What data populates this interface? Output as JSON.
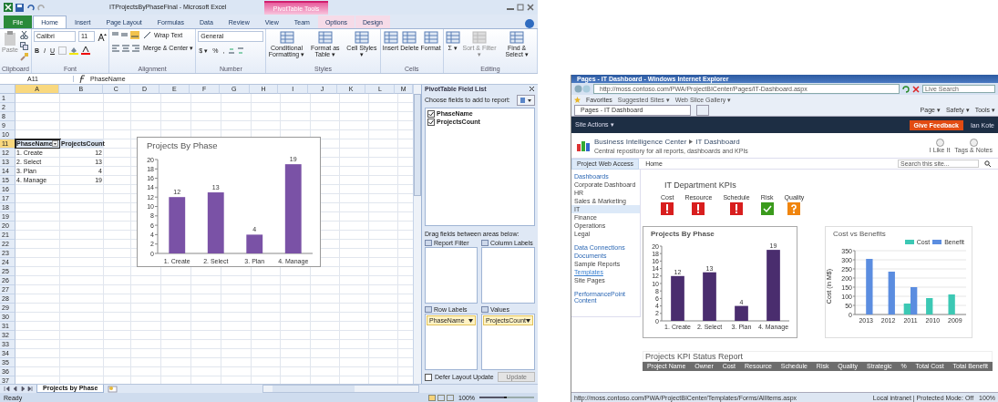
{
  "excel": {
    "title": "ITProjectsByPhaseFinal - Microsoft Excel",
    "context_label": "PivotTable Tools",
    "tabs": [
      {
        "label": "File",
        "kind": "file",
        "selected": false
      },
      {
        "label": "Home",
        "kind": "tab",
        "selected": true
      },
      {
        "label": "Insert",
        "kind": "tab",
        "selected": false
      },
      {
        "label": "Page Layout",
        "kind": "tab",
        "selected": false
      },
      {
        "label": "Formulas",
        "kind": "tab",
        "selected": false
      },
      {
        "label": "Data",
        "kind": "tab",
        "selected": false
      },
      {
        "label": "Review",
        "kind": "tab",
        "selected": false
      },
      {
        "label": "View",
        "kind": "tab",
        "selected": false
      },
      {
        "label": "Team",
        "kind": "tab",
        "selected": false
      },
      {
        "label": "Options",
        "kind": "context",
        "selected": false
      },
      {
        "label": "Design",
        "kind": "context",
        "selected": false
      }
    ],
    "groups": [
      {
        "kind": "clipboard",
        "label": "Clipboard",
        "buttons": [
          {
            "label": "Paste",
            "disabled": true
          }
        ]
      },
      {
        "kind": "font",
        "label": "Font",
        "font": "Calibri",
        "size": "11",
        "styles": [
          "B",
          "I",
          "U"
        ]
      },
      {
        "kind": "alignment",
        "label": "Alignment",
        "wrap": "Wrap Text",
        "merge": "Merge & Center ▾"
      },
      {
        "kind": "number",
        "label": "Number",
        "format": "General",
        "symbols": [
          "$ ▾",
          "%",
          ","
        ]
      },
      {
        "kind": "buttons",
        "label": "Styles",
        "buttons": [
          {
            "label": "Conditional Formatting ▾",
            "disabled": false
          },
          {
            "label": "Format as Table ▾",
            "disabled": false
          },
          {
            "label": "Cell Styles ▾",
            "disabled": false
          }
        ]
      },
      {
        "kind": "buttons",
        "label": "Cells",
        "buttons": [
          {
            "label": "Insert",
            "disabled": false
          },
          {
            "label": "Delete",
            "disabled": false
          },
          {
            "label": "Format",
            "disabled": false
          }
        ]
      },
      {
        "kind": "buttons",
        "label": "Editing",
        "buttons": [
          {
            "label": "Σ ▾",
            "disabled": false
          },
          {
            "label": "Sort & Filter ▾",
            "disabled": true
          },
          {
            "label": "Find & Select ▾",
            "disabled": false
          }
        ]
      }
    ],
    "name_box": "A11",
    "formula": "PhaseName",
    "columns": [
      {
        "label": "A",
        "selected": true
      },
      {
        "label": "B",
        "selected": false
      },
      {
        "label": "C",
        "selected": false
      },
      {
        "label": "D",
        "selected": false
      },
      {
        "label": "E",
        "selected": false
      },
      {
        "label": "F",
        "selected": false
      },
      {
        "label": "G",
        "selected": false
      },
      {
        "label": "H",
        "selected": false
      },
      {
        "label": "I",
        "selected": false
      },
      {
        "label": "J",
        "selected": false
      },
      {
        "label": "K",
        "selected": false
      },
      {
        "label": "L",
        "selected": false
      },
      {
        "label": "M",
        "selected": false
      }
    ],
    "rows": [
      {
        "label": "1",
        "selected": false,
        "cells": []
      },
      {
        "label": "2",
        "selected": false,
        "cells": []
      },
      {
        "label": "8",
        "selected": false,
        "cells": []
      },
      {
        "label": "9",
        "selected": false,
        "cells": []
      },
      {
        "label": "10",
        "selected": false,
        "cells": []
      },
      {
        "label": "11",
        "selected": true,
        "cells": [
          {
            "text": "PhaseName",
            "kind": "header",
            "selected": true
          },
          {
            "text": "ProjectsCount",
            "kind": "header",
            "selected": false
          }
        ]
      },
      {
        "label": "12",
        "selected": false,
        "cells": [
          {
            "text": "1. Create",
            "kind": "text",
            "selected": false
          },
          {
            "text": "12",
            "kind": "number",
            "selected": false
          }
        ]
      },
      {
        "label": "13",
        "selected": false,
        "cells": [
          {
            "text": "2. Select",
            "kind": "text",
            "selected": false
          },
          {
            "text": "13",
            "kind": "number",
            "selected": false
          }
        ]
      },
      {
        "label": "14",
        "selected": false,
        "cells": [
          {
            "text": "3. Plan",
            "kind": "text",
            "selected": false
          },
          {
            "text": "4",
            "kind": "number",
            "selected": false
          }
        ]
      },
      {
        "label": "15",
        "selected": false,
        "cells": [
          {
            "text": "4. Manage",
            "kind": "text",
            "selected": false
          },
          {
            "text": "19",
            "kind": "number",
            "selected": false
          }
        ]
      },
      {
        "label": "16",
        "selected": false,
        "cells": []
      },
      {
        "label": "17",
        "selected": false,
        "cells": []
      },
      {
        "label": "18",
        "selected": false,
        "cells": []
      },
      {
        "label": "19",
        "selected": false,
        "cells": []
      },
      {
        "label": "20",
        "selected": false,
        "cells": []
      },
      {
        "label": "21",
        "selected": false,
        "cells": []
      },
      {
        "label": "22",
        "selected": false,
        "cells": []
      },
      {
        "label": "23",
        "selected": false,
        "cells": []
      },
      {
        "label": "24",
        "selected": false,
        "cells": []
      },
      {
        "label": "25",
        "selected": false,
        "cells": []
      },
      {
        "label": "26",
        "selected": false,
        "cells": []
      },
      {
        "label": "27",
        "selected": false,
        "cells": []
      },
      {
        "label": "28",
        "selected": false,
        "cells": []
      },
      {
        "label": "29",
        "selected": false,
        "cells": []
      },
      {
        "label": "30",
        "selected": false,
        "cells": []
      },
      {
        "label": "31",
        "selected": false,
        "cells": []
      },
      {
        "label": "32",
        "selected": false,
        "cells": []
      },
      {
        "label": "33",
        "selected": false,
        "cells": []
      },
      {
        "label": "34",
        "selected": false,
        "cells": []
      },
      {
        "label": "35",
        "selected": false,
        "cells": []
      },
      {
        "label": "36",
        "selected": false,
        "cells": []
      },
      {
        "label": "37",
        "selected": false,
        "cells": []
      }
    ],
    "chart_data": {
      "type": "bar",
      "title": "Projects By Phase",
      "categories": [
        "1. Create",
        "2. Select",
        "3. Plan",
        "4. Manage"
      ],
      "series": [
        {
          "color": "#7a52a6",
          "values": [
            12,
            13,
            4,
            19
          ]
        }
      ],
      "ylim": [
        0,
        20
      ],
      "yticks": [
        0,
        2,
        4,
        6,
        8,
        10,
        12,
        14,
        16,
        18,
        20
      ],
      "data_labels": true
    },
    "pivot": {
      "title": "PivotTable Field List",
      "prompt": "Choose fields to add to report:",
      "fields": [
        {
          "label": "PhaseName",
          "checked": true
        },
        {
          "label": "ProjectsCount",
          "checked": true
        }
      ],
      "drag_prompt": "Drag fields between areas below:",
      "areas": [
        {
          "label": "Report Filter"
        },
        {
          "label": "Column Labels"
        },
        {
          "label": "Row Labels",
          "items": [
            "PhaseName"
          ]
        },
        {
          "label": "Values",
          "items": [
            "ProjectsCount"
          ]
        }
      ],
      "defer": {
        "label": "Defer Layout Update",
        "checked": false
      },
      "update": {
        "label": "Update",
        "disabled": true
      }
    },
    "sheets": [
      {
        "label": "Projects by Phase",
        "selected": true
      }
    ],
    "status": {
      "text": "Ready",
      "zoom": "100%",
      "level": 0.5
    }
  },
  "browser": {
    "title": "Pages - IT Dashboard - Windows Internet Explorer",
    "address": "http://moss.contoso.com/PWA/ProjectBICenter/Pages/IT-Dashboard.aspx",
    "search_placeholder": "Live Search",
    "favorites": "Favorites",
    "links": [
      "Suggested Sites ▾",
      "Web Slice Gallery ▾"
    ],
    "tab": "Pages - IT Dashboard",
    "commands": [
      "Page ▾",
      "Safety ▾",
      "Tools ▾"
    ],
    "site_actions": "Site Actions ▾",
    "feedback": "Give Feedback",
    "user": "Ian Kote",
    "site_title": "Business Intelligence Center",
    "page_title": "IT Dashboard",
    "description": "Central repository for all reports, dashboards and KPIs",
    "actions": [
      "I Like It",
      "Tags & Notes"
    ],
    "nav": [
      {
        "label": "Project Web Access",
        "selected": true
      },
      {
        "label": "Home",
        "selected": false
      }
    ],
    "site_search": "Search this site...",
    "quick_launch": [
      {
        "label": "Dashboards",
        "kind": "heading",
        "selected": false
      },
      {
        "label": "Corporate Dashboard",
        "kind": "item",
        "selected": false
      },
      {
        "label": "HR",
        "kind": "item",
        "selected": false
      },
      {
        "label": "Sales & Marketing",
        "kind": "item",
        "selected": false
      },
      {
        "label": "IT",
        "kind": "item",
        "selected": true
      },
      {
        "label": "Finance",
        "kind": "item",
        "selected": false
      },
      {
        "label": "Operations",
        "kind": "item",
        "selected": false
      },
      {
        "label": "Legal",
        "kind": "item",
        "selected": false
      },
      {
        "label": "Data Connections",
        "kind": "section",
        "selected": false
      },
      {
        "label": "Documents",
        "kind": "heading",
        "selected": false
      },
      {
        "label": "Sample Reports",
        "kind": "item",
        "selected": false
      },
      {
        "label": "Templates",
        "kind": "link",
        "selected": false
      },
      {
        "label": "Site Pages",
        "kind": "item",
        "selected": false
      },
      {
        "label": "PerformancePoint Content",
        "kind": "section",
        "selected": false
      }
    ],
    "kpi_title": "IT Department KPIs",
    "kpis": [
      {
        "label": "Cost",
        "kind": "alert"
      },
      {
        "label": "Resource",
        "kind": "alert"
      },
      {
        "label": "Schedule",
        "kind": "alert"
      },
      {
        "label": "Risk",
        "kind": "ok"
      },
      {
        "label": "Quality",
        "kind": "unknown"
      }
    ],
    "phase_chart": {
      "chart_data": {
        "type": "bar",
        "title": "Projects By Phase",
        "categories": [
          "1. Create",
          "2. Select",
          "3. Plan",
          "4. Manage"
        ],
        "series": [
          {
            "color": "#4a2d6e",
            "values": [
              12,
              13,
              4,
              19
            ]
          }
        ],
        "ylim": [
          0,
          20
        ],
        "yticks": [
          0,
          2,
          4,
          6,
          8,
          10,
          12,
          14,
          16,
          18,
          20
        ],
        "data_labels": true
      }
    },
    "cost_chart": {
      "chart_data": {
        "type": "bar",
        "title": "Cost vs Benefits",
        "ylabel": "Cost (in M$)",
        "categories": [
          "2013",
          "2012",
          "2011",
          "2010",
          "2009"
        ],
        "grid": true,
        "series": [
          {
            "name": "Cost",
            "color": "#3cc8b4",
            "values": [
              null,
              null,
              60,
              90,
              110
            ]
          },
          {
            "name": "Benefit",
            "color": "#5b8de0",
            "values": [
              305,
              235,
              150,
              null,
              null
            ]
          }
        ],
        "ylim": [
          0,
          350
        ],
        "yticks": [
          0,
          50,
          100,
          150,
          200,
          250,
          300,
          350
        ]
      }
    },
    "report_title": "Projects KPI Status Report",
    "report_columns": [
      "Project Name",
      "Owner",
      "Cost",
      "Resource",
      "Schedule",
      "Risk",
      "Quality",
      "Strategic",
      "%",
      "Total Cost",
      "Total Benefit"
    ],
    "status_url": "http://moss.contoso.com/PWA/ProjectBICenter/Templates/Forms/AllItems.aspx",
    "zone": "Local intranet | Protected Mode: Off",
    "zoom": "100%"
  }
}
